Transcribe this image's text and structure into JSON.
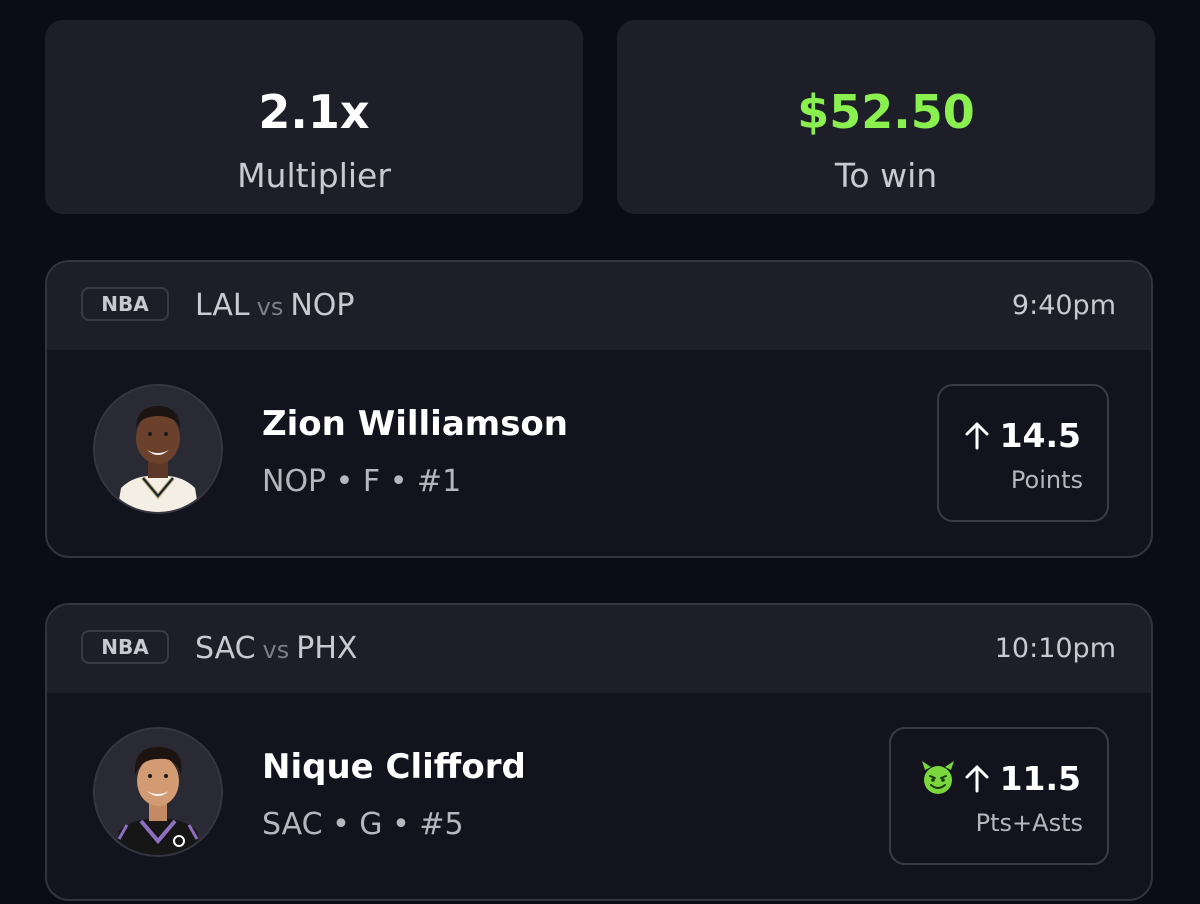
{
  "summary": {
    "multiplier_value": "2.1x",
    "multiplier_label": "Multiplier",
    "to_win_value": "$52.50",
    "to_win_label": "To win",
    "to_win_color": "#8af04f"
  },
  "picks": [
    {
      "league": "NBA",
      "team_a": "LAL",
      "vs": "vs",
      "team_b": "NOP",
      "time": "9:40pm",
      "player_name": "Zion Williamson",
      "player_meta": "NOP • F • #1",
      "direction_icon": "arrow-up-icon",
      "line": "14.5",
      "stat": "Points"
    },
    {
      "league": "NBA",
      "team_a": "SAC",
      "vs": "vs",
      "team_b": "PHX",
      "time": "10:10pm",
      "player_name": "Nique Clifford",
      "player_meta": "SAC • G • #5",
      "boost_icon": "demon-icon",
      "direction_icon": "arrow-up-icon",
      "line": "11.5",
      "stat": "Pts+Asts"
    }
  ]
}
